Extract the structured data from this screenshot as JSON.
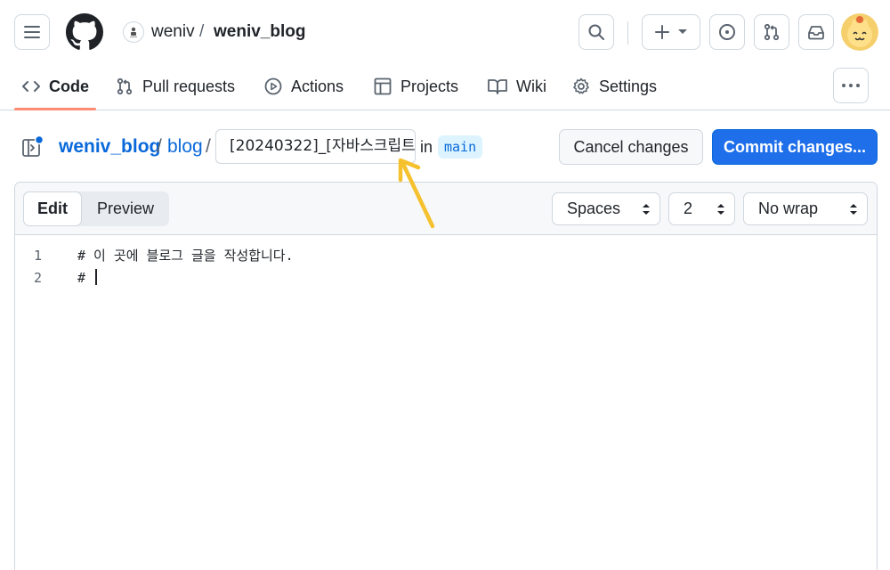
{
  "header": {
    "owner": "weniv",
    "separator": "/",
    "repo": "weniv_blog"
  },
  "nav": {
    "code": "Code",
    "pull_requests": "Pull requests",
    "actions": "Actions",
    "projects": "Projects",
    "wiki": "Wiki",
    "settings": "Settings"
  },
  "breadcrumb": {
    "repo": "weniv_blog",
    "sep": "/",
    "dir": "blog",
    "filename_value": "[20240322]_[자바스크립트",
    "in_text": "in",
    "branch": "main"
  },
  "actions": {
    "cancel": "Cancel changes",
    "commit": "Commit changes..."
  },
  "editor": {
    "tabs": {
      "edit": "Edit",
      "preview": "Preview"
    },
    "indent_mode": "Spaces",
    "indent_size": "2",
    "wrap_mode": "No wrap",
    "lines": [
      {
        "number": "1",
        "text": "# 이 곳에 블로그 글을 작성합니다."
      },
      {
        "number": "2",
        "text": "# "
      }
    ]
  },
  "colors": {
    "accent_blue": "#0969da",
    "commit_button": "#1f6feb",
    "active_tab_underline": "#fd8c73",
    "annotation_arrow": "#f5c12e"
  },
  "icons": [
    "menu-icon",
    "github-logo",
    "search-icon",
    "plus-icon",
    "issue-icon",
    "pull-request-icon",
    "inbox-icon",
    "code-icon",
    "play-icon",
    "table-icon",
    "book-icon",
    "gear-icon",
    "kebab-icon",
    "file-tree-icon"
  ]
}
